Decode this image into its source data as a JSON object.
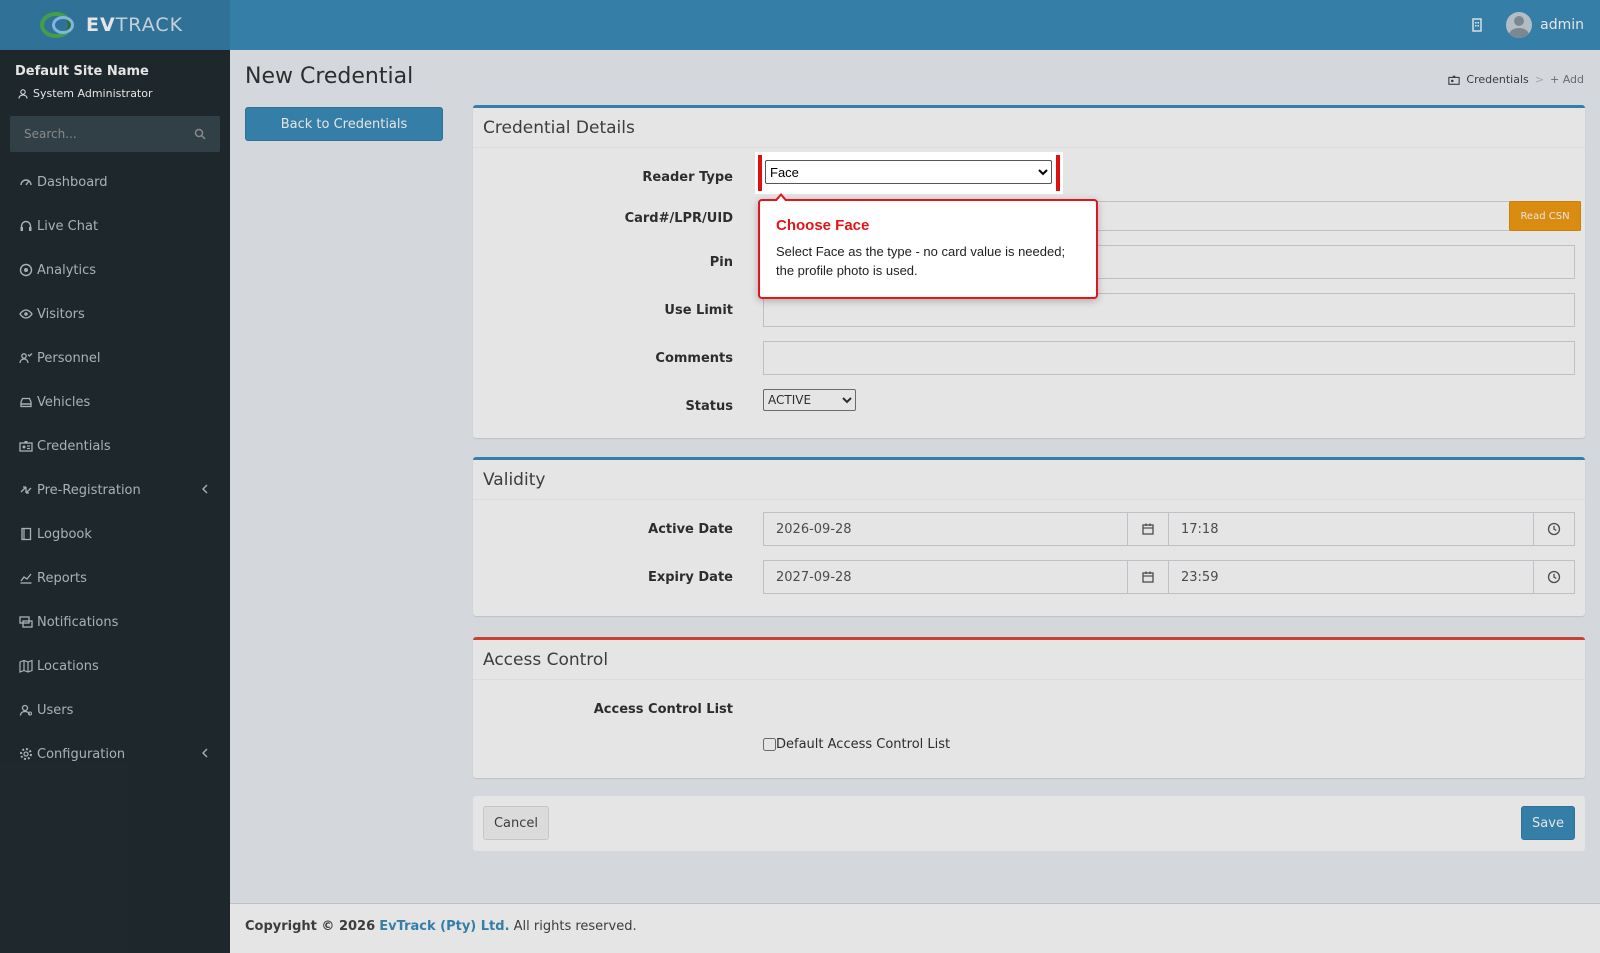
{
  "header": {
    "logo_bold": "EV",
    "logo_rest": "TRACK",
    "user_name": "admin"
  },
  "sidebar": {
    "site_name": "Default Site Name",
    "site_role": "System Administrator",
    "search_placeholder": "Search...",
    "items": [
      {
        "label": "Dashboard",
        "icon": "dashboard-icon"
      },
      {
        "label": "Live Chat",
        "icon": "headset-icon"
      },
      {
        "label": "Analytics",
        "icon": "target-icon"
      },
      {
        "label": "Visitors",
        "icon": "eye-icon"
      },
      {
        "label": "Personnel",
        "icon": "people-icon"
      },
      {
        "label": "Vehicles",
        "icon": "car-icon"
      },
      {
        "label": "Credentials",
        "icon": "id-card-icon"
      },
      {
        "label": "Pre-Registration",
        "icon": "exchange-icon"
      },
      {
        "label": "Logbook",
        "icon": "book-icon"
      },
      {
        "label": "Reports",
        "icon": "chart-icon"
      },
      {
        "label": "Notifications",
        "icon": "chat-icon"
      },
      {
        "label": "Locations",
        "icon": "map-icon"
      },
      {
        "label": "Users",
        "icon": "user-icon"
      },
      {
        "label": "Configuration",
        "icon": "gear-icon"
      }
    ]
  },
  "page": {
    "title": "New Credential",
    "back_button": "Back to Credentials",
    "breadcrumb": {
      "item1": "Credentials",
      "sep": ">",
      "item2": "+ Add"
    }
  },
  "credential_details": {
    "title": "Credential Details",
    "reader_type_label": "Reader Type",
    "reader_type_value": "Face",
    "card_label": "Card#/LPR/UID",
    "read_csn_button": "Read CSN",
    "pin_label": "Pin",
    "use_limit_label": "Use Limit",
    "comments_label": "Comments",
    "status_label": "Status",
    "status_value": "ACTIVE"
  },
  "validity": {
    "title": "Validity",
    "active_date_label": "Active Date",
    "active_date": "2026-09-28",
    "active_time": "17:18",
    "expiry_date_label": "Expiry Date",
    "expiry_date": "2027-09-28",
    "expiry_time": "23:59"
  },
  "access_control": {
    "title": "Access Control",
    "list_label": "Access Control List",
    "checkbox_label": "Default Access Control List"
  },
  "actions": {
    "cancel": "Cancel",
    "save": "Save"
  },
  "footer": {
    "copyright": "Copyright © 2026",
    "brand": "EvTrack (Pty) Ltd.",
    "rights": "All rights reserved."
  },
  "tooltip": {
    "title": "Choose Face",
    "body": "Select Face as the type - no card value is needed; the profile photo is used."
  },
  "colors": {
    "header": "#3c8dbc",
    "sidebar": "#222d32",
    "warning": "#f39c12",
    "danger": "#dd4b39",
    "tooltip_accent": "#e3151a"
  }
}
